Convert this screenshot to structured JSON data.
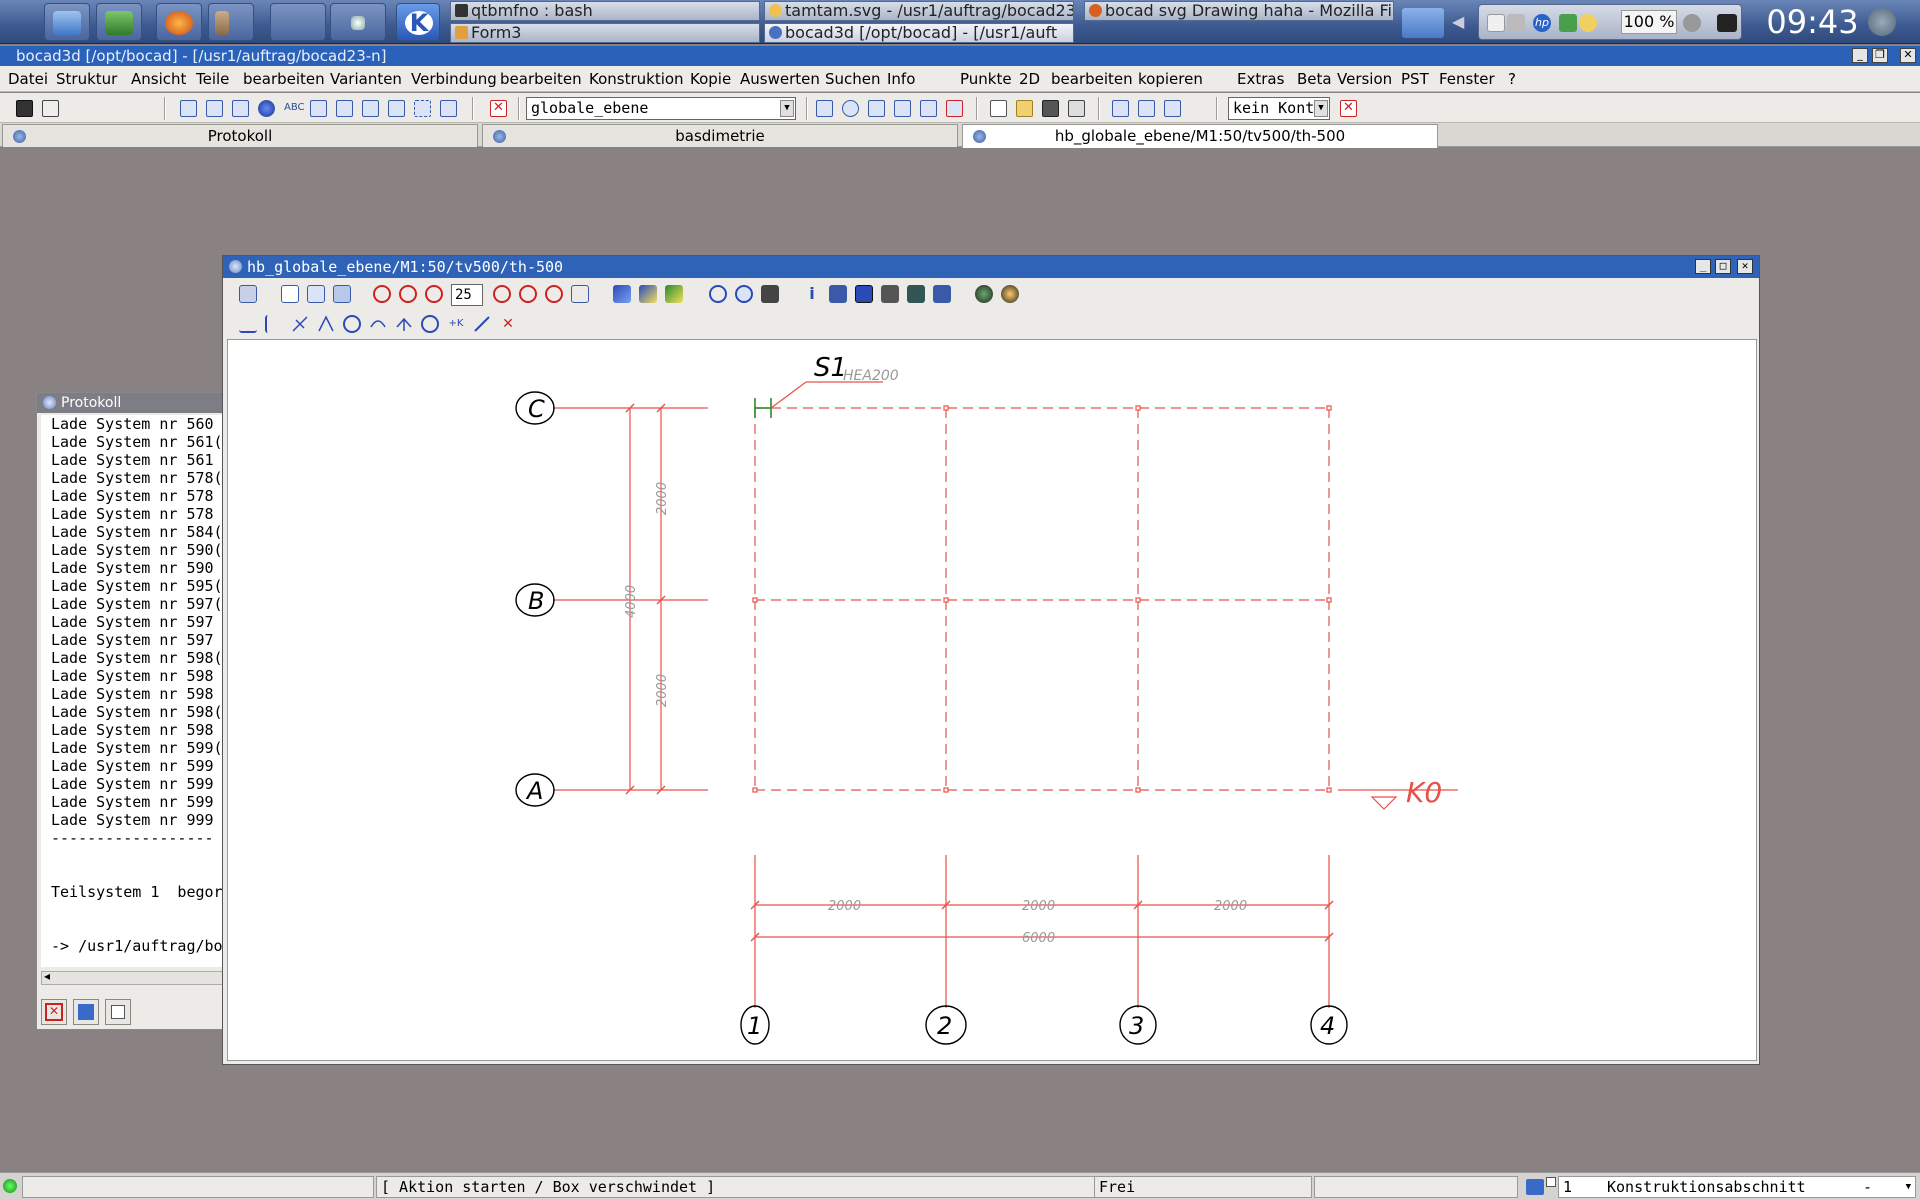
{
  "panel": {
    "tasks": [
      {
        "label": "qtbmfno : bash",
        "icon": "terminal-icon"
      },
      {
        "label": "Form3",
        "icon": "form-icon"
      },
      {
        "label": "tamtam.svg - /usr1/auftrag/bocad23",
        "icon": "svg-file-icon"
      },
      {
        "label": "bocad3d  [/opt/bocad]  -  [/usr1/auft",
        "icon": "bocad-icon"
      },
      {
        "label": "bocad svg Drawing haha - Mozilla Fir",
        "icon": "firefox-icon"
      }
    ],
    "volume": "100 %",
    "clock": "09:43"
  },
  "main_window": {
    "title": "bocad3d  [/opt/bocad]  -  [/usr1/auftrag/bocad23-n]",
    "controls": {
      "minimize": "_",
      "restore": "❐",
      "close": "✕"
    }
  },
  "menubar": [
    "Datei",
    "Struktur",
    "Ansicht",
    "Teile",
    "bearbeiten",
    "Varianten",
    "Verbindung",
    "bearbeiten",
    "Konstruktion",
    "Kopie",
    "Auswerten",
    "Suchen",
    "Info",
    "Punkte",
    "2D",
    "bearbeiten",
    "kopieren",
    "Extras",
    "Beta",
    "Version",
    "PST",
    "Fenster",
    "?"
  ],
  "toolbar": {
    "layer_combo": "globale_ebene",
    "context_combo": "kein Kont"
  },
  "tabs": [
    {
      "label": "Protokoll"
    },
    {
      "label": "basdimetrie"
    },
    {
      "label": "hb_globale_ebene/M1:50/tv500/th-500"
    }
  ],
  "protokoll": {
    "title": "Protokoll",
    "lines": [
      "Lade System nr 560",
      "Lade System nr 561(",
      "Lade System nr 561",
      "Lade System nr 578(",
      "Lade System nr 578",
      "Lade System nr 578",
      "Lade System nr 584(",
      "Lade System nr 590(",
      "Lade System nr 590",
      "Lade System nr 595(",
      "Lade System nr 597(",
      "Lade System nr 597",
      "Lade System nr 597",
      "Lade System nr 598(",
      "Lade System nr 598",
      "Lade System nr 598",
      "Lade System nr 598(",
      "Lade System nr 598",
      "Lade System nr 599(",
      "Lade System nr 599",
      "Lade System nr 599",
      "Lade System nr 599",
      "Lade System nr 999",
      "------------------",
      "",
      "",
      "Teilsystem 1  begor",
      "",
      "",
      "-> /usr1/auftrag/bo"
    ],
    "scroll_left": "◂"
  },
  "drawing_window": {
    "title": "hb_globale_ebene/M1:50/tv500/th-500",
    "zoom_value": "25",
    "controls": {
      "minimize": "_",
      "maximize": "□",
      "close": "✕"
    }
  },
  "drawing": {
    "column_label": "S1",
    "profile_label": "HEA200",
    "axes_letters": [
      "C",
      "B",
      "A"
    ],
    "axes_numbers": [
      "1",
      "2",
      "3",
      "4"
    ],
    "dim_vertical": [
      "2000",
      "2000"
    ],
    "dim_vertical_total": "4000",
    "dim_horizontal": [
      "2000",
      "2000",
      "2000"
    ],
    "dim_horizontal_total": "6000",
    "level_label": "K0",
    "line_color": "#e8504a",
    "dim_color": "#999999"
  },
  "statusbar": {
    "action": "[ Aktion starten / Box verschwindet ]",
    "state": "Frei",
    "section_number": "1",
    "section_label": "Konstruktionsabschnitt",
    "section_dash": "-"
  }
}
